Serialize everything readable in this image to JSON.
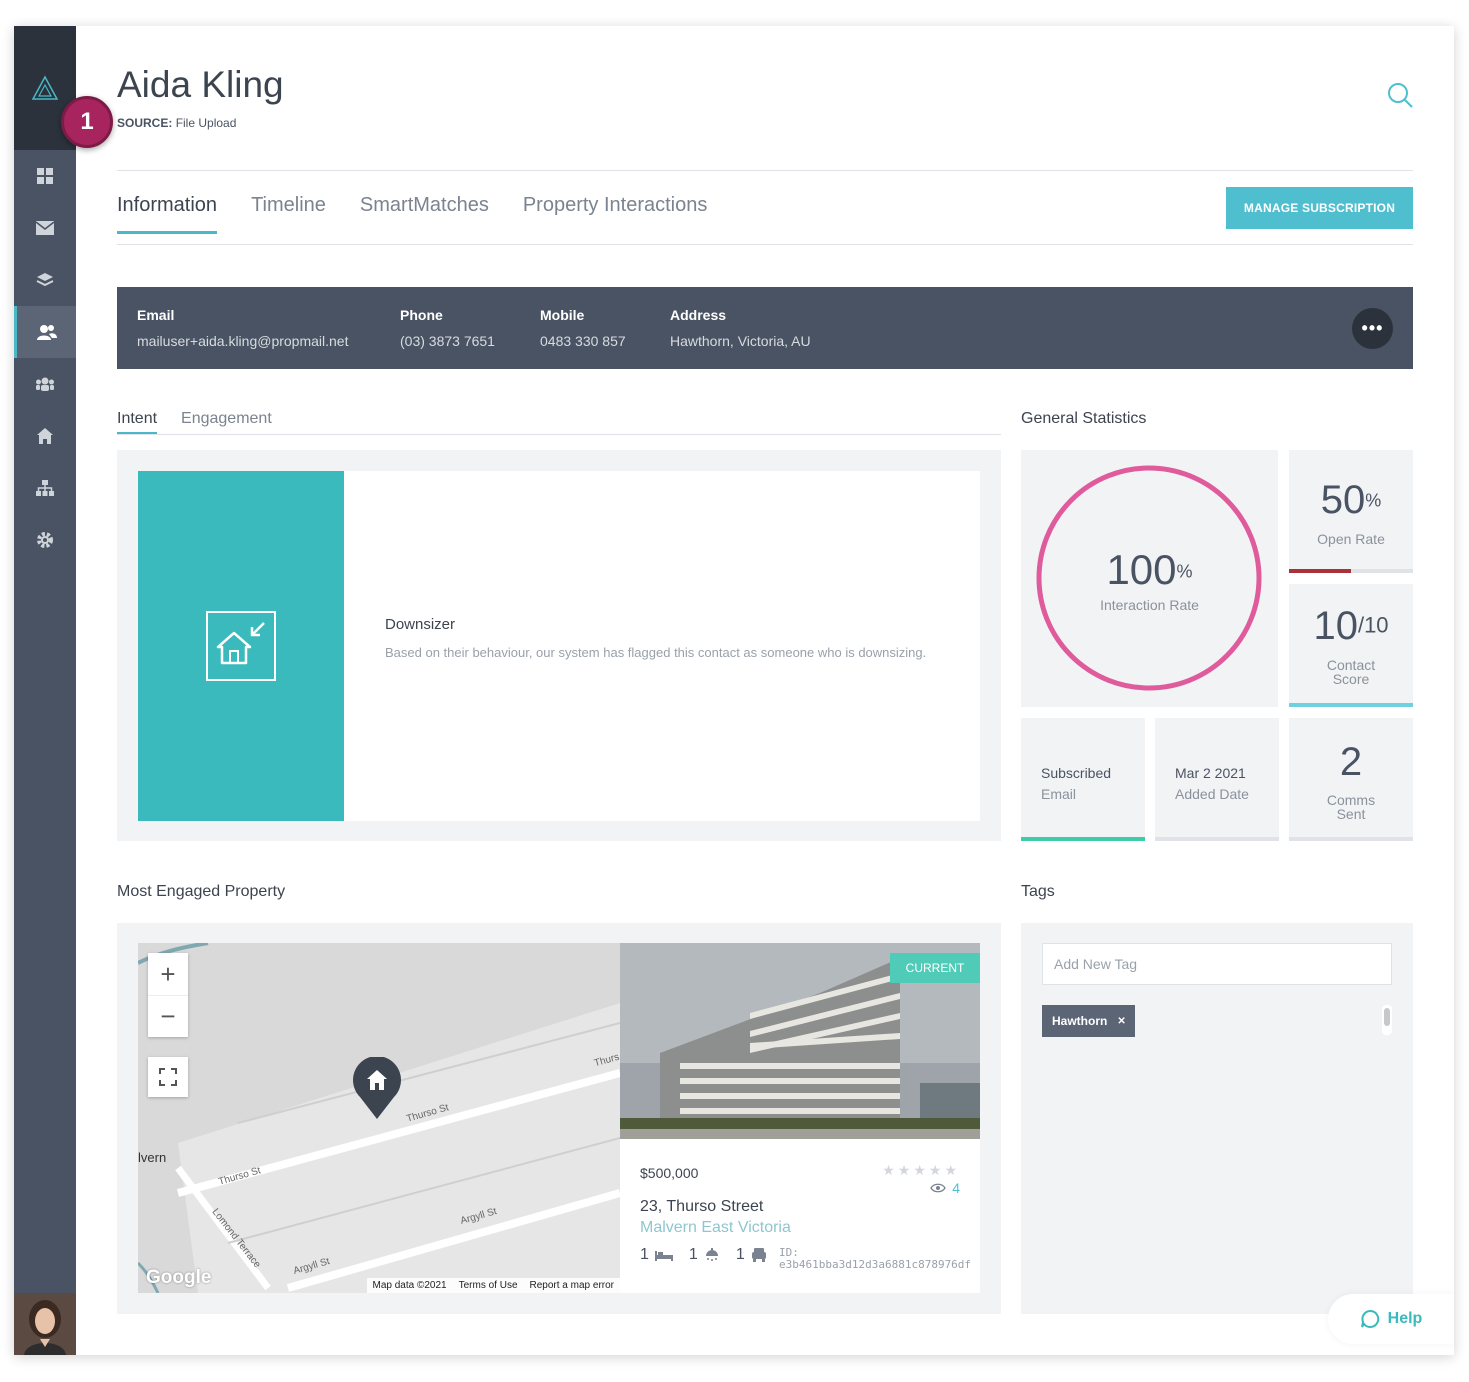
{
  "contact": {
    "name": "Aida Kling",
    "source_label": "SOURCE:",
    "source_value": "File Upload",
    "step_badge": "1"
  },
  "tabs": [
    {
      "label": "Information",
      "active": true
    },
    {
      "label": "Timeline",
      "active": false
    },
    {
      "label": "SmartMatches",
      "active": false
    },
    {
      "label": "Property Interactions",
      "active": false
    }
  ],
  "manage_subscription_label": "MANAGE SUBSCRIPTION",
  "info_bar": {
    "email_label": "Email",
    "email_value": "mailuser+aida.kling@propmail.net",
    "phone_label": "Phone",
    "phone_value": "(03) 3873 7651",
    "mobile_label": "Mobile",
    "mobile_value": "0483 330 857",
    "address_label": "Address",
    "address_value": "Hawthorn, Victoria, AU",
    "more_label": "•••"
  },
  "subtabs": [
    {
      "label": "Intent",
      "active": true
    },
    {
      "label": "Engagement",
      "active": false
    }
  ],
  "intent": {
    "title": "Downsizer",
    "description": "Based on their behaviour, our system has flagged this contact as someone who is downsizing."
  },
  "general_statistics": {
    "title": "General Statistics",
    "interaction_rate_value": "100",
    "interaction_rate_unit": "%",
    "interaction_rate_label": "Interaction Rate",
    "interaction_rate_pct": 100,
    "open_rate_value": "50",
    "open_rate_unit": "%",
    "open_rate_label": "Open Rate",
    "open_rate_fraction": 0.5,
    "contact_score_value": "10",
    "contact_score_denominator": "/10",
    "contact_score_label_1": "Contact",
    "contact_score_label_2": "Score",
    "subscribed_line1": "Subscribed",
    "subscribed_line2": "Email",
    "added_date_line1": "Mar 2 2021",
    "added_date_line2": "Added Date",
    "comms_value": "2",
    "comms_label_1": "Comms",
    "comms_label_2": "Sent"
  },
  "most_engaged": {
    "title": "Most Engaged Property",
    "map": {
      "street_labels": [
        "Thurso St",
        "Thurso St",
        "Argyll St",
        "Argyll St",
        "Lomond Terrace",
        "Thurs",
        "lvern"
      ],
      "footer": [
        "Map data ©2021",
        "Terms of Use",
        "Report a map error"
      ],
      "google_label": "Google",
      "zoom_in": "+",
      "zoom_out": "−"
    },
    "property": {
      "badge": "CURRENT",
      "price": "$500,000",
      "views": "4",
      "address_line1": "23, Thurso Street",
      "address_line2": "Malvern East Victoria",
      "beds": "1",
      "baths": "1",
      "cars": "1",
      "id_label": "ID:",
      "id_value": "e3b461bba3d12d3a6881c878976df",
      "rating": 0
    }
  },
  "tags": {
    "title": "Tags",
    "input_placeholder": "Add New Tag",
    "items": [
      {
        "label": "Hawthorn",
        "remove": "✕"
      }
    ]
  },
  "help_label": "Help",
  "colors": {
    "accent_teal": "#4fbfcf",
    "intent_teal": "#3ababc",
    "sidebar": "#4a5363",
    "ring_pink": "#e05b9c",
    "open_rate_bar": "#a8313a",
    "subscribed_bar": "#3fcbaa",
    "score_bar": "#6fd0e0",
    "badge_purple": "#a8245f"
  }
}
